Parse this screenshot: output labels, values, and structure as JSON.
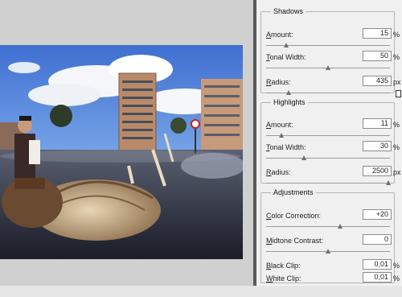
{
  "shadows": {
    "title": "Shadows",
    "rows": [
      {
        "label_a": "A",
        "label_b": "mount:",
        "value": "15",
        "unit": "%",
        "level": 0.15
      },
      {
        "label_a": "T",
        "label_b": "onal Width:",
        "value": "50",
        "unit": "%",
        "level": 0.5
      },
      {
        "label_a": "R",
        "label_b": "adius:",
        "value": "435",
        "unit": "px",
        "level": 0.17
      }
    ]
  },
  "highlights": {
    "title": "Highlights",
    "rows": [
      {
        "label_a": "A",
        "label_b": "mount:",
        "value": "11",
        "unit": "%",
        "level": 0.11
      },
      {
        "label_a": "T",
        "label_b": "onal Width:",
        "value": "30",
        "unit": "%",
        "level": 0.3
      },
      {
        "label_a": "R",
        "label_b": "adius:",
        "value": "2500",
        "unit": "px",
        "level": 1.0
      }
    ]
  },
  "adjustments": {
    "title": "Adjustments",
    "rows": [
      {
        "label_a": "C",
        "label_b": "olor Correction:",
        "value": "+20",
        "unit": "",
        "level": 0.6
      },
      {
        "label_a": "M",
        "label_b": "idtone Contrast:",
        "value": "0",
        "unit": "",
        "level": 0.5
      }
    ],
    "clips": [
      {
        "label_a": "B",
        "label_b": "lack Clip:",
        "value": "0,01",
        "unit": "%"
      },
      {
        "label_a": "W",
        "label_b": "hite Clip:",
        "value": "0,01",
        "unit": "%"
      }
    ]
  },
  "icons": {
    "photo": "photo-canvas-icon",
    "edge": "panel-edge-icon"
  }
}
